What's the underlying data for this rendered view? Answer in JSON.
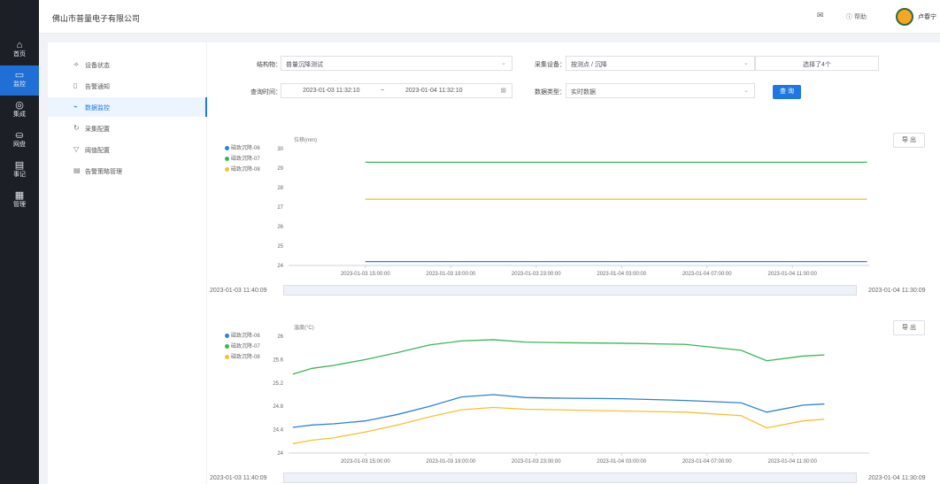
{
  "rail": {
    "items": [
      {
        "icon": "⌂",
        "label": "首页",
        "active": false
      },
      {
        "icon": "▭",
        "label": "监控",
        "active": true
      },
      {
        "icon": "◎",
        "label": "集成",
        "active": false
      },
      {
        "icon": "⛀",
        "label": "网盘",
        "active": false
      },
      {
        "icon": "▤",
        "label": "事记",
        "active": false
      },
      {
        "icon": "▦",
        "label": "管理",
        "active": false
      }
    ]
  },
  "topbar": {
    "company": "佛山市普量电子有限公司",
    "mail_icon": "✉",
    "help_label": "ⓘ 帮助",
    "user_name": "卢春宁"
  },
  "subnav": {
    "items": [
      {
        "icon": "⟢",
        "label": "设备状态",
        "active": false
      },
      {
        "icon": "▯",
        "label": "告警通知",
        "active": false
      },
      {
        "icon": "⌁",
        "label": "数据监控",
        "active": true
      },
      {
        "icon": "↻",
        "label": "采集配置",
        "active": false
      },
      {
        "icon": "▽",
        "label": "阈值配置",
        "active": false
      },
      {
        "icon": "▤",
        "label": "告警策略管理",
        "active": false
      }
    ]
  },
  "filters": {
    "structure_label": "结构物：",
    "structure_value": "普量沉降测试",
    "device_label": "采集设备：",
    "device_value": "按测点 / 沉降",
    "device_selected": "选择了4个",
    "time_label": "查询时间：",
    "time_start": "2023-01-03 11:32:10",
    "time_sep": "~",
    "time_end": "2023-01-04 11:32:10",
    "data_type_label": "数据类型：",
    "data_type_value": "实时数据",
    "query_label": "查 询"
  },
  "colors": {
    "blue": "#2f80d8",
    "green": "#3cb45a",
    "yellow": "#f2c230",
    "accent": "#1f77e0"
  },
  "chart1": {
    "export_label": "导 出",
    "slider_start": "2023-01-03 11:40:09",
    "slider_end": "2023-01-04 11:30:09"
  },
  "chart2": {
    "export_label": "导 出",
    "slider_start": "2023-01-03 11:40:09",
    "slider_end": "2023-01-04 11:30:09"
  },
  "chart_data": [
    {
      "type": "line",
      "ylabel": "位移(mm)",
      "ylim": [
        24,
        30
      ],
      "yticks": [
        "30",
        "29",
        "28",
        "27",
        "26",
        "25",
        "24"
      ],
      "xtick_labels": [
        "2023-01-03 15:00:00",
        "2023-01-03 19:00:00",
        "2023-01-03 23:00:00",
        "2023-01-04 03:00:00",
        "2023-01-04 07:00:00",
        "2023-01-04 11:00:00"
      ],
      "x_hours": [
        0,
        4,
        8,
        12,
        16,
        20,
        23.5
      ],
      "series": [
        {
          "name": "磁致沉降-06",
          "color": "#2f80d8",
          "values": [
            24.2,
            24.2,
            24.2,
            24.2,
            24.2,
            24.2,
            24.2
          ]
        },
        {
          "name": "磁致沉降-07",
          "color": "#3cb45a",
          "values": [
            29.3,
            29.3,
            29.3,
            29.3,
            29.3,
            29.3,
            29.3
          ]
        },
        {
          "name": "磁致沉降-08",
          "color": "#f2c230",
          "values": [
            27.4,
            27.4,
            27.4,
            27.4,
            27.4,
            27.4,
            27.4
          ]
        }
      ],
      "grid": false,
      "legend": "left"
    },
    {
      "type": "line",
      "ylabel": "温度(°C)",
      "ylim": [
        24,
        26
      ],
      "yticks": [
        "26",
        "25.6",
        "25.2",
        "24.8",
        "24.4",
        "24"
      ],
      "xtick_labels": [
        "2023-01-03 15:00:00",
        "2023-01-03 19:00:00",
        "2023-01-03 23:00:00",
        "2023-01-04 03:00:00",
        "2023-01-04 07:00:00",
        "2023-01-04 11:00:00"
      ],
      "x_hours": [
        -3.4,
        -2.5,
        -1.5,
        0,
        1.5,
        3,
        4.5,
        6,
        7.5,
        9,
        12,
        15,
        17.6,
        18.8,
        20.5,
        21.5
      ],
      "series": [
        {
          "name": "磁致沉降-06",
          "color": "#2f80d8",
          "values": [
            24.44,
            24.48,
            24.5,
            24.55,
            24.66,
            24.8,
            24.96,
            25.0,
            24.95,
            24.94,
            24.93,
            24.9,
            24.86,
            24.7,
            24.82,
            24.84
          ]
        },
        {
          "name": "磁致沉降-07",
          "color": "#3cb45a",
          "values": [
            25.35,
            25.45,
            25.5,
            25.6,
            25.72,
            25.85,
            25.92,
            25.94,
            25.9,
            25.89,
            25.88,
            25.86,
            25.76,
            25.58,
            25.66,
            25.68
          ]
        },
        {
          "name": "磁致沉降-08",
          "color": "#f2c230",
          "values": [
            24.16,
            24.22,
            24.26,
            24.36,
            24.48,
            24.62,
            24.74,
            24.78,
            24.75,
            24.74,
            24.72,
            24.7,
            24.64,
            24.43,
            24.55,
            24.58
          ]
        }
      ],
      "grid": false,
      "legend": "left"
    }
  ]
}
